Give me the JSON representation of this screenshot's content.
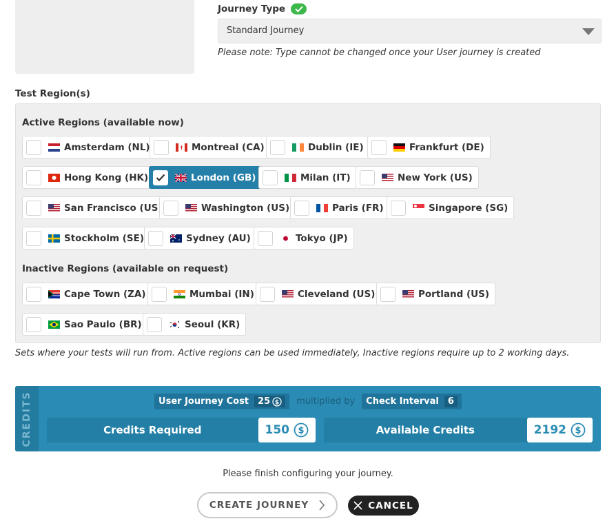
{
  "journey_type": {
    "label": "Journey Type",
    "selected": "Standard Journey",
    "note": "Please note: Type cannot be changed once your User journey is created"
  },
  "test_regions": {
    "label": "Test Region(s)",
    "active_heading": "Active Regions (available now)",
    "inactive_heading": "Inactive Regions (available on request)",
    "active": [
      {
        "label": "Amsterdam (NL)",
        "flag": "nl-flag",
        "selected": false
      },
      {
        "label": "Montreal (CA)",
        "flag": "ca-flag",
        "selected": false
      },
      {
        "label": "Dublin (IE)",
        "flag": "ie-flag",
        "selected": false
      },
      {
        "label": "Frankfurt (DE)",
        "flag": "de-flag",
        "selected": false
      },
      {
        "label": "Hong Kong (HK)",
        "flag": "hk-flag",
        "selected": false
      },
      {
        "label": "London (GB)",
        "flag": "gb-flag",
        "selected": true
      },
      {
        "label": "Milan (IT)",
        "flag": "it-flag",
        "selected": false
      },
      {
        "label": "New York (US)",
        "flag": "us-flag",
        "selected": false
      },
      {
        "label": "San Francisco (US)",
        "flag": "us-flag",
        "selected": false
      },
      {
        "label": "Washington (US)",
        "flag": "us-flag",
        "selected": false
      },
      {
        "label": "Paris (FR)",
        "flag": "fr-flag",
        "selected": false
      },
      {
        "label": "Singapore (SG)",
        "flag": "sg-flag",
        "selected": false
      },
      {
        "label": "Stockholm (SE)",
        "flag": "se-flag",
        "selected": false
      },
      {
        "label": "Sydney (AU)",
        "flag": "au-flag",
        "selected": false
      },
      {
        "label": "Tokyo (JP)",
        "flag": "jp-flag",
        "selected": false
      }
    ],
    "inactive": [
      {
        "label": "Cape Town (ZA)",
        "flag": "za-flag",
        "selected": false
      },
      {
        "label": "Mumbai (IN)",
        "flag": "in-flag",
        "selected": false
      },
      {
        "label": "Cleveland (US)",
        "flag": "us-flag",
        "selected": false
      },
      {
        "label": "Portland (US)",
        "flag": "us-flag",
        "selected": false
      },
      {
        "label": "Sao Paulo (BR)",
        "flag": "br-flag",
        "selected": false
      },
      {
        "label": "Seoul (KR)",
        "flag": "kr-flag",
        "selected": false
      }
    ],
    "note": "Sets where your tests will run from. Active regions can be used immediately, Inactive regions require up to 2 working days."
  },
  "credits": {
    "side_label": "CREDITS",
    "journey_cost_label": "User Journey Cost",
    "journey_cost_value": "25",
    "multiplied_by": "multiplied by",
    "check_interval_label": "Check Interval",
    "check_interval_value": "6",
    "required_label": "Credits Required",
    "required_value": "150",
    "available_label": "Available Credits",
    "available_value": "2192",
    "accent": "#2a8cb4"
  },
  "footer": {
    "message": "Please finish configuring your journey.",
    "create_label": "CREATE JOURNEY",
    "cancel_label": "CANCEL"
  }
}
